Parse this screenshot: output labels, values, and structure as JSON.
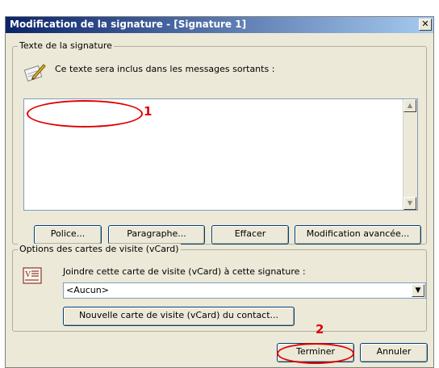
{
  "window": {
    "title": "Modification de la signature - [Signature 1]",
    "close_label": "×"
  },
  "signature_text": {
    "group_label": "Texte de la signature",
    "info_text": "Ce texte sera inclus dans les messages sortants :",
    "content": "",
    "buttons": {
      "font": "Police...",
      "paragraph": "Paragraphe...",
      "clear": "Effacer",
      "advanced": "Modification avancée..."
    }
  },
  "vcard": {
    "group_label": "Options des cartes de visite (vCard)",
    "attach_label": "Joindre cette carte de visite (vCard) à cette signature :",
    "selected": "<Aucun>",
    "new_button": "Nouvelle carte de visite (vCard) du contact..."
  },
  "footer": {
    "finish": "Terminer",
    "cancel": "Annuler"
  },
  "annotations": {
    "marker_1": "1",
    "marker_2": "2",
    "color": "#e00000"
  },
  "icons": {
    "signature": "pen-paper-icon",
    "vcard": "vcard-icon"
  }
}
